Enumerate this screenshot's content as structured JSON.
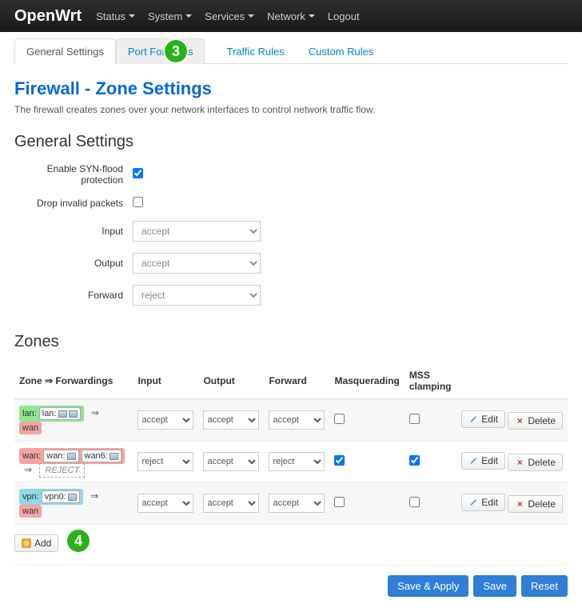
{
  "navbar": {
    "brand": "OpenWrt",
    "items": [
      "Status",
      "System",
      "Services",
      "Network",
      "Logout"
    ]
  },
  "tabs": {
    "items": [
      "General Settings",
      "Port Forwards",
      "Traffic Rules",
      "Custom Rules"
    ],
    "active_index": 0,
    "highlight_index": 1
  },
  "annotations": {
    "badge3": "3",
    "badge4": "4"
  },
  "page": {
    "title": "Firewall - Zone Settings",
    "desc": "The firewall creates zones over your network interfaces to control network traffic flow."
  },
  "general": {
    "heading": "General Settings",
    "rows": {
      "syn": {
        "label": "Enable SYN-flood protection",
        "checked": true
      },
      "drop": {
        "label": "Drop invalid packets",
        "checked": false
      },
      "input": {
        "label": "Input",
        "value": "accept"
      },
      "output": {
        "label": "Output",
        "value": "accept"
      },
      "forward": {
        "label": "Forward",
        "value": "reject"
      }
    }
  },
  "zones": {
    "heading": "Zones",
    "columns": [
      "Zone ⇒ Forwardings",
      "Input",
      "Output",
      "Forward",
      "Masquerading",
      "MSS clamping",
      ""
    ],
    "edit_label": "Edit",
    "delete_label": "Delete",
    "add_label": "Add",
    "reject_text": "REJECT",
    "rows": [
      {
        "name": "lan",
        "name_label": "lan:",
        "ifaces": [
          "lan:"
        ],
        "iface_count": 2,
        "fwd": "wan",
        "input": "accept",
        "output": "accept",
        "forward": "accept",
        "masq": false,
        "mss": false,
        "color": "lan"
      },
      {
        "name": "wan",
        "name_label": "wan:",
        "ifaces": [
          "wan:",
          "wan6:"
        ],
        "iface_count": 1,
        "fwd": "REJECT",
        "fwd_reject": true,
        "input": "reject",
        "output": "accept",
        "forward": "reject",
        "masq": true,
        "mss": true,
        "color": "wan"
      },
      {
        "name": "vpn",
        "name_label": "vpn:",
        "ifaces": [
          "vpn0:"
        ],
        "iface_count": 1,
        "fwd": "wan",
        "input": "accept",
        "output": "accept",
        "forward": "accept",
        "masq": false,
        "mss": false,
        "color": "vpn"
      }
    ]
  },
  "footer": {
    "save_apply": "Save & Apply",
    "save": "Save",
    "reset": "Reset"
  }
}
